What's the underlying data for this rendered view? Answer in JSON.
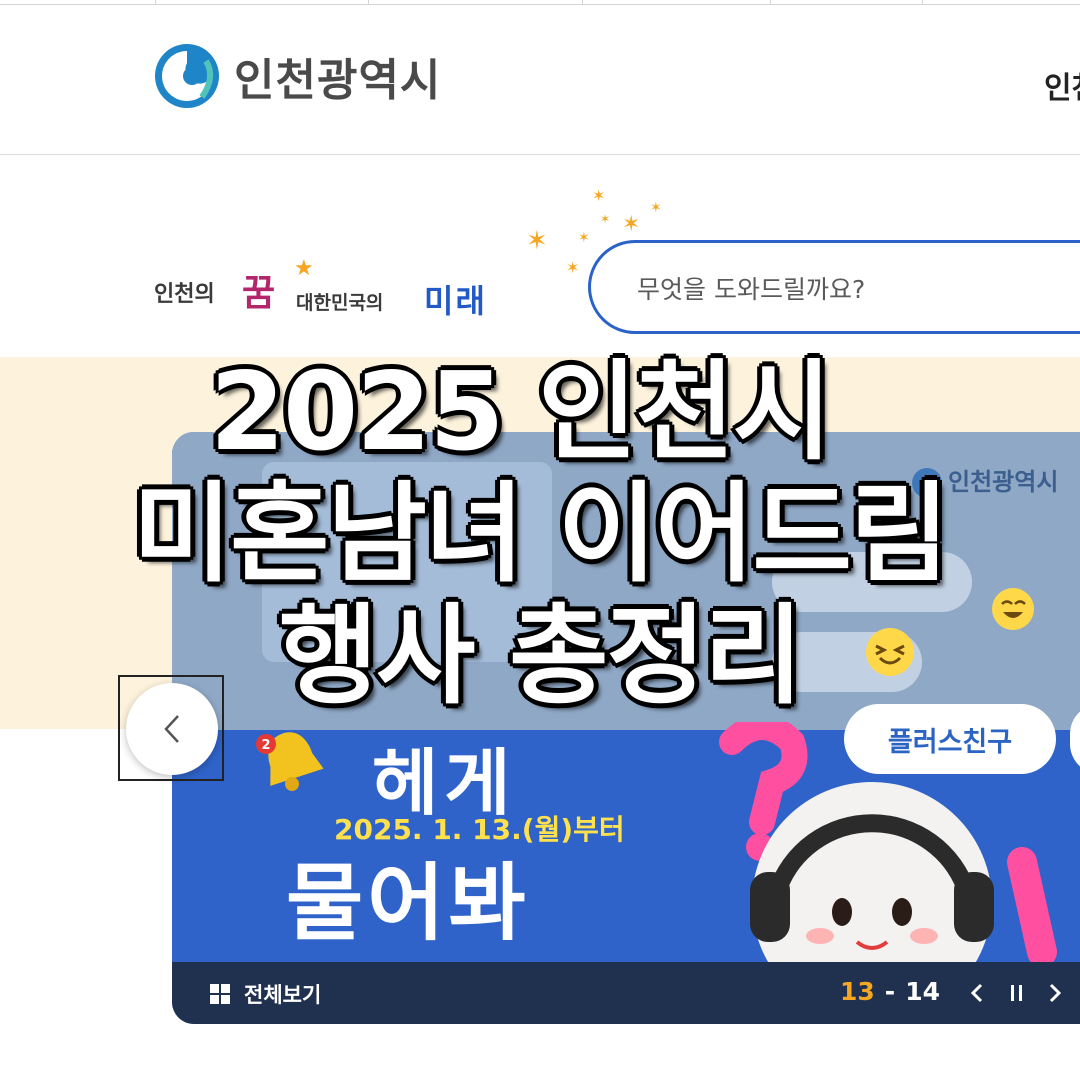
{
  "header": {
    "logo_text": "인천광역시",
    "nav_partial": "인천"
  },
  "slogan": {
    "part1": "인천의",
    "kkum": "꿈",
    "part2": "대한민국의",
    "mirae": "미래"
  },
  "search": {
    "placeholder": "무엇을 도와드릴까요?"
  },
  "banner": {
    "card_logo": "인천광역시",
    "headline_top": "헤게",
    "date_text": "2025. 1. 13.(월)부터",
    "headline_bottom": "물어봐",
    "pill_label": "플러스친구",
    "bell_badge": "2"
  },
  "slider_bar": {
    "view_all_label": "전체보기",
    "current": "13",
    "separator": "-",
    "total": "14"
  },
  "overlay_title": {
    "line1": "2025 인천시",
    "line2": "미혼남녀 이어드림",
    "line3": "행사 총정리"
  },
  "colors": {
    "brand_blue": "#2a62c9",
    "banner_bg": "#fdf3dd",
    "bar_navy": "#20314f",
    "accent_orange": "#f5a623",
    "kkum_magenta": "#b3266b"
  }
}
